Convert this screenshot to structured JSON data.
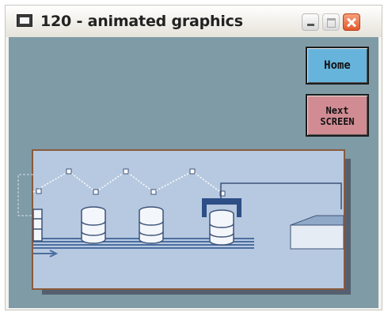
{
  "window": {
    "title": "120 - animated graphics",
    "icons": {
      "app": "app-window-icon",
      "minimize": "minimize-icon",
      "maximize": "maximize-icon",
      "close": "close-icon"
    }
  },
  "nav": {
    "home_label": "Home",
    "next_label_line1": "Next",
    "next_label_line2": "SCREEN"
  },
  "colors": {
    "client_bg": "#7f9ba6",
    "panel_bg": "#b7c9e0",
    "home_button": "#66b4dc",
    "next_button": "#d18c93",
    "close_button": "#e2582b"
  },
  "animation": {
    "description_items": [
      "canister",
      "canister",
      "canister",
      "canister-in-gripper"
    ]
  }
}
